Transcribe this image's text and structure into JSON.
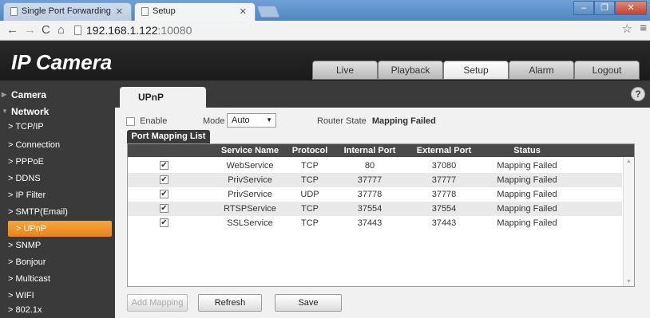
{
  "browser": {
    "tabs": [
      {
        "label": "Single Port Forwarding"
      },
      {
        "label": "Setup"
      }
    ],
    "url_host": "192.168.1.122",
    "url_port": ":10080"
  },
  "app": {
    "logo": "IP Camera",
    "nav": [
      "Live",
      "Playback",
      "Setup",
      "Alarm",
      "Logout"
    ],
    "active_nav": "Setup"
  },
  "sidebar": {
    "groups": [
      {
        "label": "Camera",
        "expanded": false
      },
      {
        "label": "Network",
        "expanded": true
      }
    ],
    "items": [
      {
        "label": "TCP/IP"
      },
      {
        "label": "Connection"
      },
      {
        "label": "PPPoE"
      },
      {
        "label": "DDNS"
      },
      {
        "label": "IP Filter"
      },
      {
        "label": "SMTP(Email)"
      },
      {
        "label": "UPnP",
        "active": true
      },
      {
        "label": "SNMP"
      },
      {
        "label": "Bonjour"
      },
      {
        "label": "Multicast"
      },
      {
        "label": "WIFI"
      },
      {
        "label": "802.1x"
      }
    ],
    "active_color": "#f0981f"
  },
  "main": {
    "tab": "UPnP",
    "enable_label": "Enable",
    "mode_label": "Mode",
    "mode_value": "Auto",
    "router_state_label": "Router State",
    "router_state_value": "Mapping Failed",
    "list_tab": "Port Mapping List",
    "columns": [
      "Service Name",
      "Protocol",
      "Internal Port",
      "External Port",
      "Status"
    ],
    "rows": [
      [
        "WebService",
        "TCP",
        "80",
        "37080",
        "Mapping Failed"
      ],
      [
        "PrivService",
        "TCP",
        "37777",
        "37777",
        "Mapping Failed"
      ],
      [
        "PrivService",
        "UDP",
        "37778",
        "37778",
        "Mapping Failed"
      ],
      [
        "RTSPService",
        "TCP",
        "37554",
        "37554",
        "Mapping Failed"
      ],
      [
        "SSLService",
        "TCP",
        "37443",
        "37443",
        "Mapping Failed"
      ]
    ],
    "buttons": {
      "add_mapping": "Add Mapping",
      "refresh": "Refresh",
      "save": "Save"
    }
  }
}
